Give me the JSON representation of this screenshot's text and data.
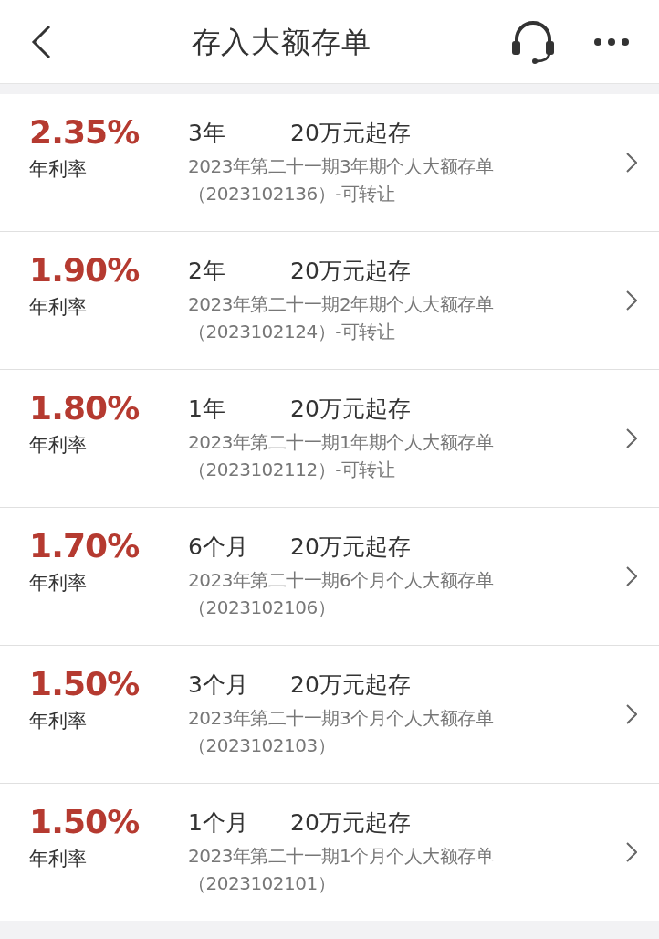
{
  "header": {
    "title": "存入大额存单"
  },
  "products": [
    {
      "rate": "2.35%",
      "rate_label": "年利率",
      "term": "3年",
      "min_deposit": "20万元起存",
      "name": "2023年第二十一期3年期个人大额存单",
      "code": "（2023102136）-可转让"
    },
    {
      "rate": "1.90%",
      "rate_label": "年利率",
      "term": "2年",
      "min_deposit": "20万元起存",
      "name": "2023年第二十一期2年期个人大额存单",
      "code": "（2023102124）-可转让"
    },
    {
      "rate": "1.80%",
      "rate_label": "年利率",
      "term": "1年",
      "min_deposit": "20万元起存",
      "name": "2023年第二十一期1年期个人大额存单",
      "code": "（2023102112）-可转让"
    },
    {
      "rate": "1.70%",
      "rate_label": "年利率",
      "term": "6个月",
      "min_deposit": "20万元起存",
      "name": "2023年第二十一期6个月个人大额存单",
      "code": "（2023102106）"
    },
    {
      "rate": "1.50%",
      "rate_label": "年利率",
      "term": "3个月",
      "min_deposit": "20万元起存",
      "name": "2023年第二十一期3个月个人大额存单",
      "code": "（2023102103）"
    },
    {
      "rate": "1.50%",
      "rate_label": "年利率",
      "term": "1个月",
      "min_deposit": "20万元起存",
      "name": "2023年第二十一期1个月个人大额存单",
      "code": "（2023102101）"
    }
  ]
}
